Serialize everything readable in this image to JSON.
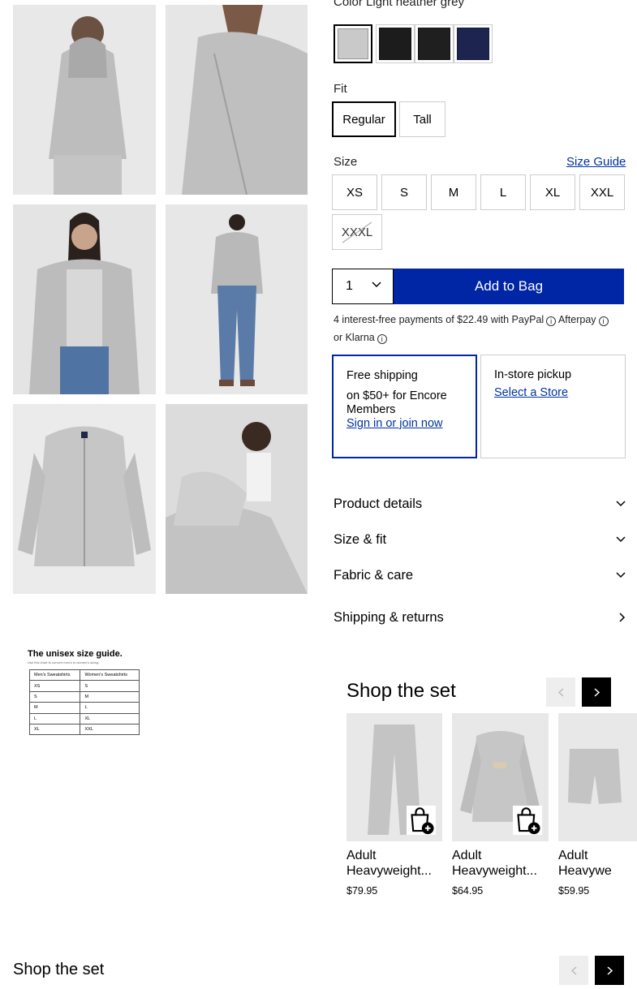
{
  "product": {
    "color_prefix": "Color",
    "color_name": "Light heather grey",
    "swatches": [
      {
        "name": "Light heather grey",
        "hex": "#c9c9c9",
        "selected": true
      },
      {
        "name": "Black",
        "hex": "#1c1c1c",
        "selected": false
      },
      {
        "name": "Black 2",
        "hex": "#1f1f1f",
        "selected": false
      },
      {
        "name": "Navy",
        "hex": "#1d2450",
        "selected": false
      }
    ],
    "fit_label": "Fit",
    "fit_options": [
      "Regular",
      "Tall"
    ],
    "fit_selected": "Regular",
    "size_label": "Size",
    "size_guide": "Size Guide",
    "sizes": [
      "XS",
      "S",
      "M",
      "L",
      "XL",
      "XXL",
      "XXXL"
    ],
    "quantity": "1",
    "add_to_bag": "Add to Bag",
    "payments": {
      "text": "4 interest-free payments of $22.49 with PayPal",
      "afterpay": "Afterpay",
      "klarna": "or Klarna"
    },
    "shipping": {
      "free_title": "Free shipping",
      "free_desc": "on $50+ for Encore Members",
      "free_link": "Sign in or join now",
      "pickup_title": "In-store pickup",
      "pickup_link": "Select a Store"
    },
    "accordions": [
      "Product details",
      "Size & fit",
      "Fabric & care",
      "Shipping & returns"
    ]
  },
  "size_chart": {
    "title": "The unisex size guide.",
    "subtitle": "Use this chart to convert men's to women's sizing.",
    "headers": [
      "Men's Sweatshirts",
      "Women's Sweatshirts"
    ],
    "rows": [
      [
        "XS",
        "S"
      ],
      [
        "S",
        "M"
      ],
      [
        "M",
        "L"
      ],
      [
        "L",
        "XL"
      ],
      [
        "XL",
        "XXL"
      ]
    ]
  },
  "shop_the_set": {
    "title": "Shop the set",
    "items": [
      {
        "name": "Adult Heavyweight...",
        "price": "$79.95"
      },
      {
        "name": "Adult Heavyweight...",
        "price": "$64.95"
      },
      {
        "name": "Adult Heavywe",
        "price": "$59.95"
      }
    ]
  },
  "shop_the_set_2": {
    "title": "Shop the set"
  },
  "colors": {
    "accent_blue": "#0025a5",
    "link_blue": "#0033a0",
    "heather": "#c9c9c9"
  }
}
